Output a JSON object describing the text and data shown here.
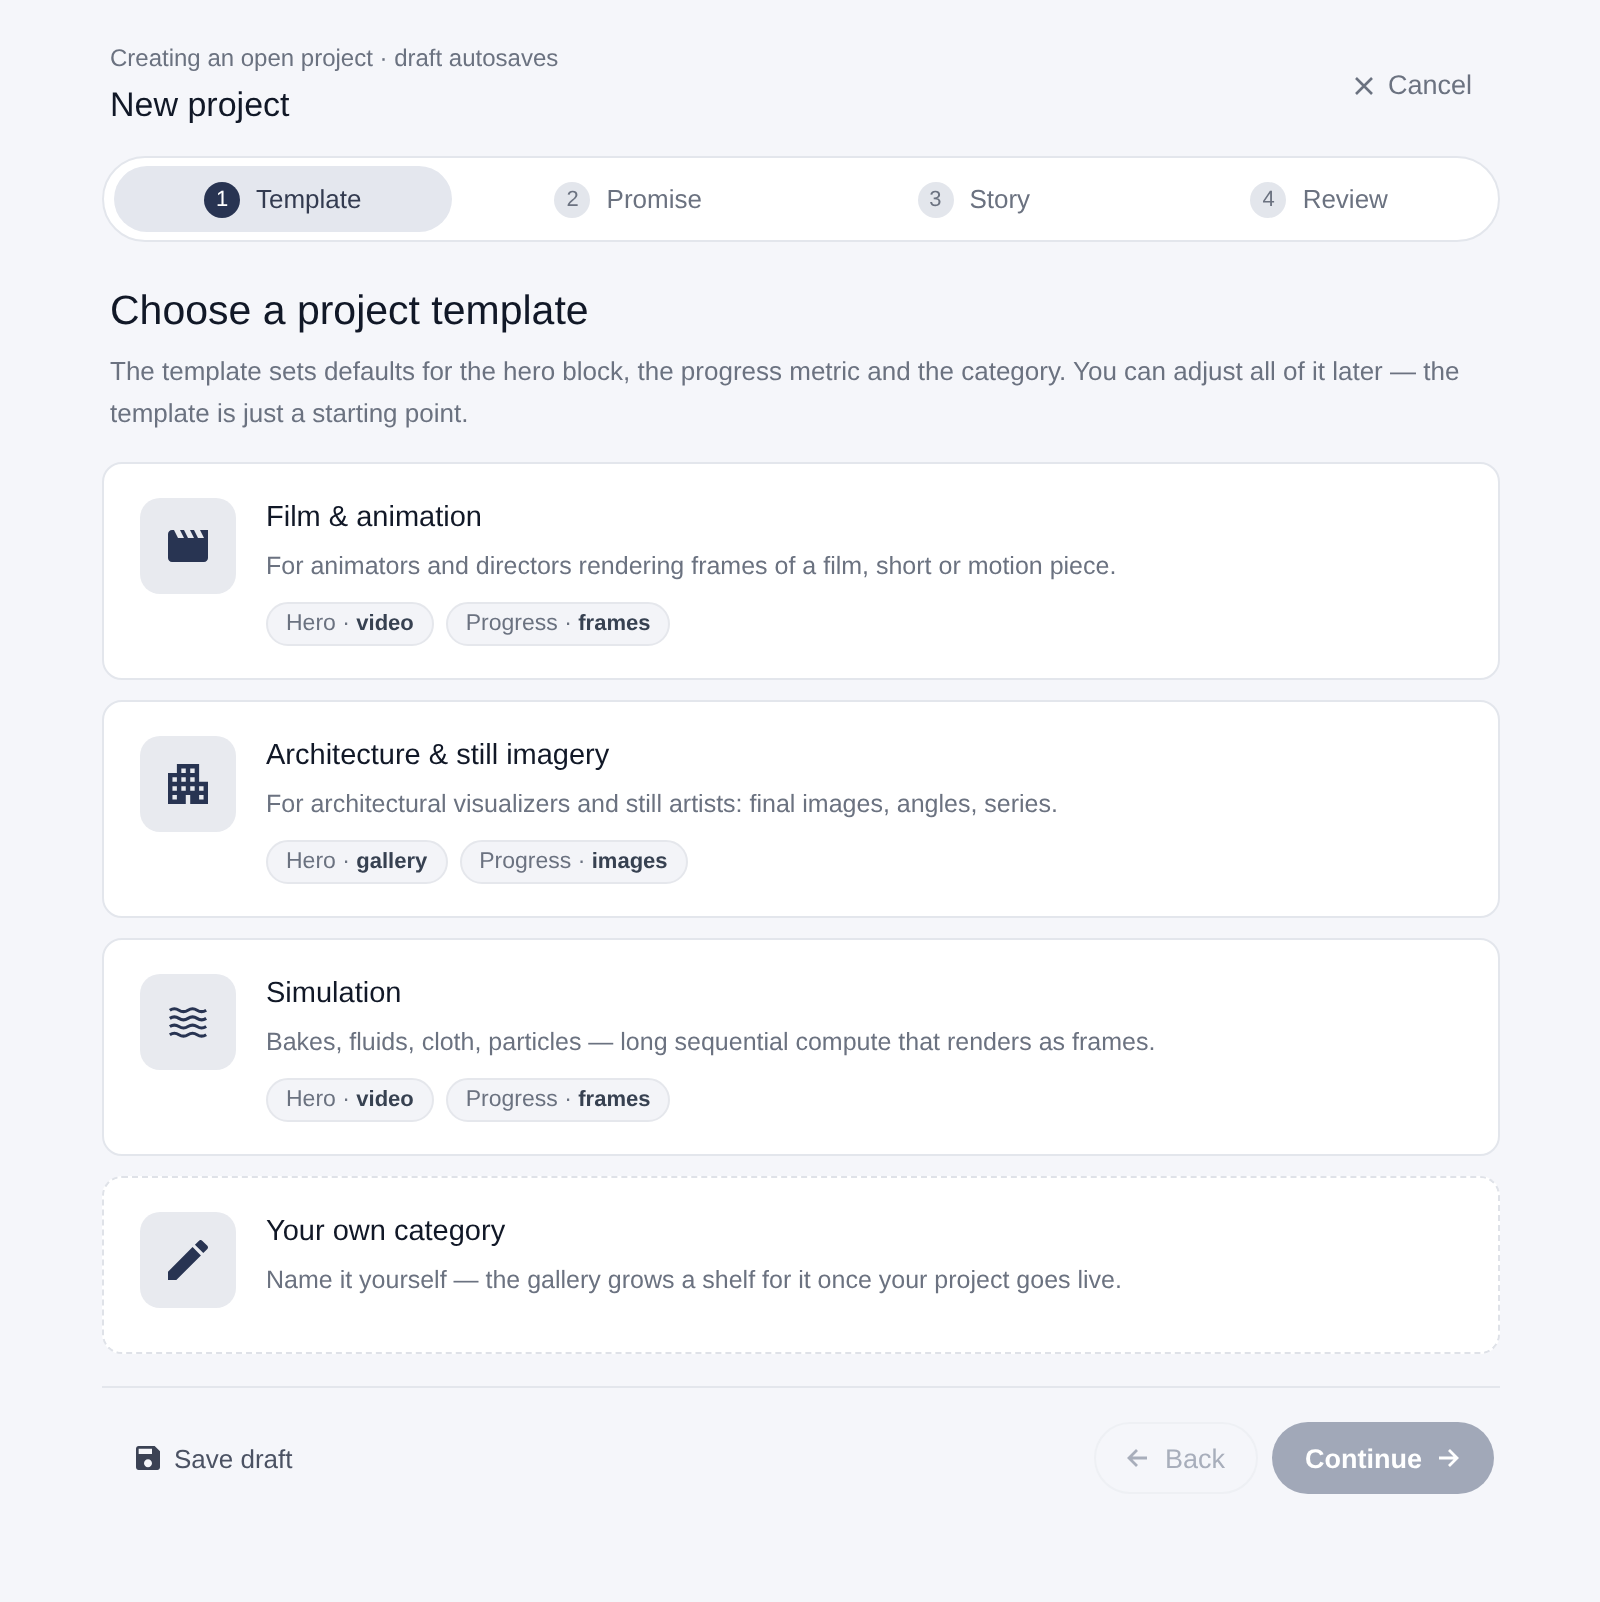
{
  "header": {
    "subtitle": "Creating an open project · draft autosaves",
    "title": "New project",
    "cancel": "Cancel"
  },
  "steps": [
    {
      "number": "1",
      "label": "Template",
      "selected": true
    },
    {
      "number": "2",
      "label": "Promise",
      "selected": false
    },
    {
      "number": "3",
      "label": "Story",
      "selected": false
    },
    {
      "number": "4",
      "label": "Review",
      "selected": false
    }
  ],
  "section": {
    "heading": "Choose a project template",
    "description": "The template sets defaults for the hero block, the progress metric and the category. You can adjust all of it later — the template is just a starting point."
  },
  "templates": [
    {
      "kind": "template",
      "title": "Film & animation",
      "description": "For animators and directors rendering frames of a film, short or motion piece.",
      "tags": [
        "Hero · **video**",
        "Progress · **frames**"
      ]
    },
    {
      "kind": "template",
      "title": "Architecture & still imagery",
      "description": "For architectural visualizers and still artists: final images, angles, series.",
      "tags": [
        "Hero · **gallery**",
        "Progress · **images**"
      ]
    },
    {
      "kind": "template",
      "title": "Simulation",
      "description": "Bakes, fluids, cloth, particles — long sequential compute that renders as frames.",
      "tags": [
        "Hero · **video**",
        "Progress · **frames**"
      ]
    },
    {
      "kind": "custom",
      "title": "Your own category",
      "description": "Name it yourself — the gallery grows a shelf for it once your project goes live."
    }
  ],
  "footer": {
    "save": "Save draft",
    "back": {
      "label": "Back",
      "disabled": true
    },
    "continue": {
      "label": "Continue",
      "disabled": true
    }
  }
}
